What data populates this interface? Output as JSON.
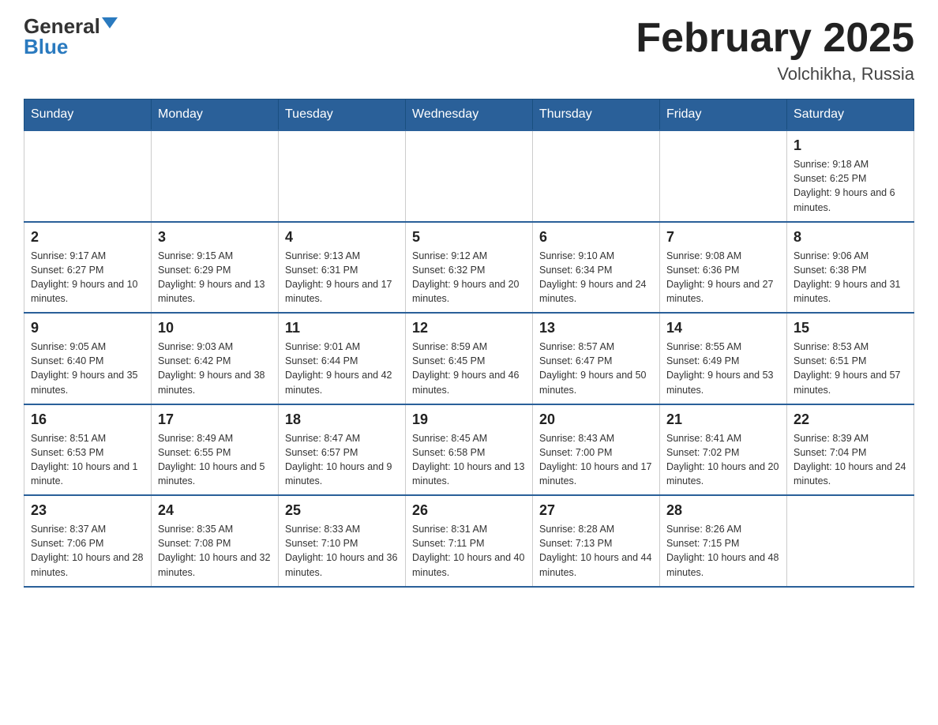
{
  "header": {
    "logo_general": "General",
    "logo_blue": "Blue",
    "month_title": "February 2025",
    "location": "Volchikha, Russia"
  },
  "weekdays": [
    "Sunday",
    "Monday",
    "Tuesday",
    "Wednesday",
    "Thursday",
    "Friday",
    "Saturday"
  ],
  "weeks": [
    [
      {
        "day": "",
        "info": ""
      },
      {
        "day": "",
        "info": ""
      },
      {
        "day": "",
        "info": ""
      },
      {
        "day": "",
        "info": ""
      },
      {
        "day": "",
        "info": ""
      },
      {
        "day": "",
        "info": ""
      },
      {
        "day": "1",
        "info": "Sunrise: 9:18 AM\nSunset: 6:25 PM\nDaylight: 9 hours and 6 minutes."
      }
    ],
    [
      {
        "day": "2",
        "info": "Sunrise: 9:17 AM\nSunset: 6:27 PM\nDaylight: 9 hours and 10 minutes."
      },
      {
        "day": "3",
        "info": "Sunrise: 9:15 AM\nSunset: 6:29 PM\nDaylight: 9 hours and 13 minutes."
      },
      {
        "day": "4",
        "info": "Sunrise: 9:13 AM\nSunset: 6:31 PM\nDaylight: 9 hours and 17 minutes."
      },
      {
        "day": "5",
        "info": "Sunrise: 9:12 AM\nSunset: 6:32 PM\nDaylight: 9 hours and 20 minutes."
      },
      {
        "day": "6",
        "info": "Sunrise: 9:10 AM\nSunset: 6:34 PM\nDaylight: 9 hours and 24 minutes."
      },
      {
        "day": "7",
        "info": "Sunrise: 9:08 AM\nSunset: 6:36 PM\nDaylight: 9 hours and 27 minutes."
      },
      {
        "day": "8",
        "info": "Sunrise: 9:06 AM\nSunset: 6:38 PM\nDaylight: 9 hours and 31 minutes."
      }
    ],
    [
      {
        "day": "9",
        "info": "Sunrise: 9:05 AM\nSunset: 6:40 PM\nDaylight: 9 hours and 35 minutes."
      },
      {
        "day": "10",
        "info": "Sunrise: 9:03 AM\nSunset: 6:42 PM\nDaylight: 9 hours and 38 minutes."
      },
      {
        "day": "11",
        "info": "Sunrise: 9:01 AM\nSunset: 6:44 PM\nDaylight: 9 hours and 42 minutes."
      },
      {
        "day": "12",
        "info": "Sunrise: 8:59 AM\nSunset: 6:45 PM\nDaylight: 9 hours and 46 minutes."
      },
      {
        "day": "13",
        "info": "Sunrise: 8:57 AM\nSunset: 6:47 PM\nDaylight: 9 hours and 50 minutes."
      },
      {
        "day": "14",
        "info": "Sunrise: 8:55 AM\nSunset: 6:49 PM\nDaylight: 9 hours and 53 minutes."
      },
      {
        "day": "15",
        "info": "Sunrise: 8:53 AM\nSunset: 6:51 PM\nDaylight: 9 hours and 57 minutes."
      }
    ],
    [
      {
        "day": "16",
        "info": "Sunrise: 8:51 AM\nSunset: 6:53 PM\nDaylight: 10 hours and 1 minute."
      },
      {
        "day": "17",
        "info": "Sunrise: 8:49 AM\nSunset: 6:55 PM\nDaylight: 10 hours and 5 minutes."
      },
      {
        "day": "18",
        "info": "Sunrise: 8:47 AM\nSunset: 6:57 PM\nDaylight: 10 hours and 9 minutes."
      },
      {
        "day": "19",
        "info": "Sunrise: 8:45 AM\nSunset: 6:58 PM\nDaylight: 10 hours and 13 minutes."
      },
      {
        "day": "20",
        "info": "Sunrise: 8:43 AM\nSunset: 7:00 PM\nDaylight: 10 hours and 17 minutes."
      },
      {
        "day": "21",
        "info": "Sunrise: 8:41 AM\nSunset: 7:02 PM\nDaylight: 10 hours and 20 minutes."
      },
      {
        "day": "22",
        "info": "Sunrise: 8:39 AM\nSunset: 7:04 PM\nDaylight: 10 hours and 24 minutes."
      }
    ],
    [
      {
        "day": "23",
        "info": "Sunrise: 8:37 AM\nSunset: 7:06 PM\nDaylight: 10 hours and 28 minutes."
      },
      {
        "day": "24",
        "info": "Sunrise: 8:35 AM\nSunset: 7:08 PM\nDaylight: 10 hours and 32 minutes."
      },
      {
        "day": "25",
        "info": "Sunrise: 8:33 AM\nSunset: 7:10 PM\nDaylight: 10 hours and 36 minutes."
      },
      {
        "day": "26",
        "info": "Sunrise: 8:31 AM\nSunset: 7:11 PM\nDaylight: 10 hours and 40 minutes."
      },
      {
        "day": "27",
        "info": "Sunrise: 8:28 AM\nSunset: 7:13 PM\nDaylight: 10 hours and 44 minutes."
      },
      {
        "day": "28",
        "info": "Sunrise: 8:26 AM\nSunset: 7:15 PM\nDaylight: 10 hours and 48 minutes."
      },
      {
        "day": "",
        "info": ""
      }
    ]
  ]
}
